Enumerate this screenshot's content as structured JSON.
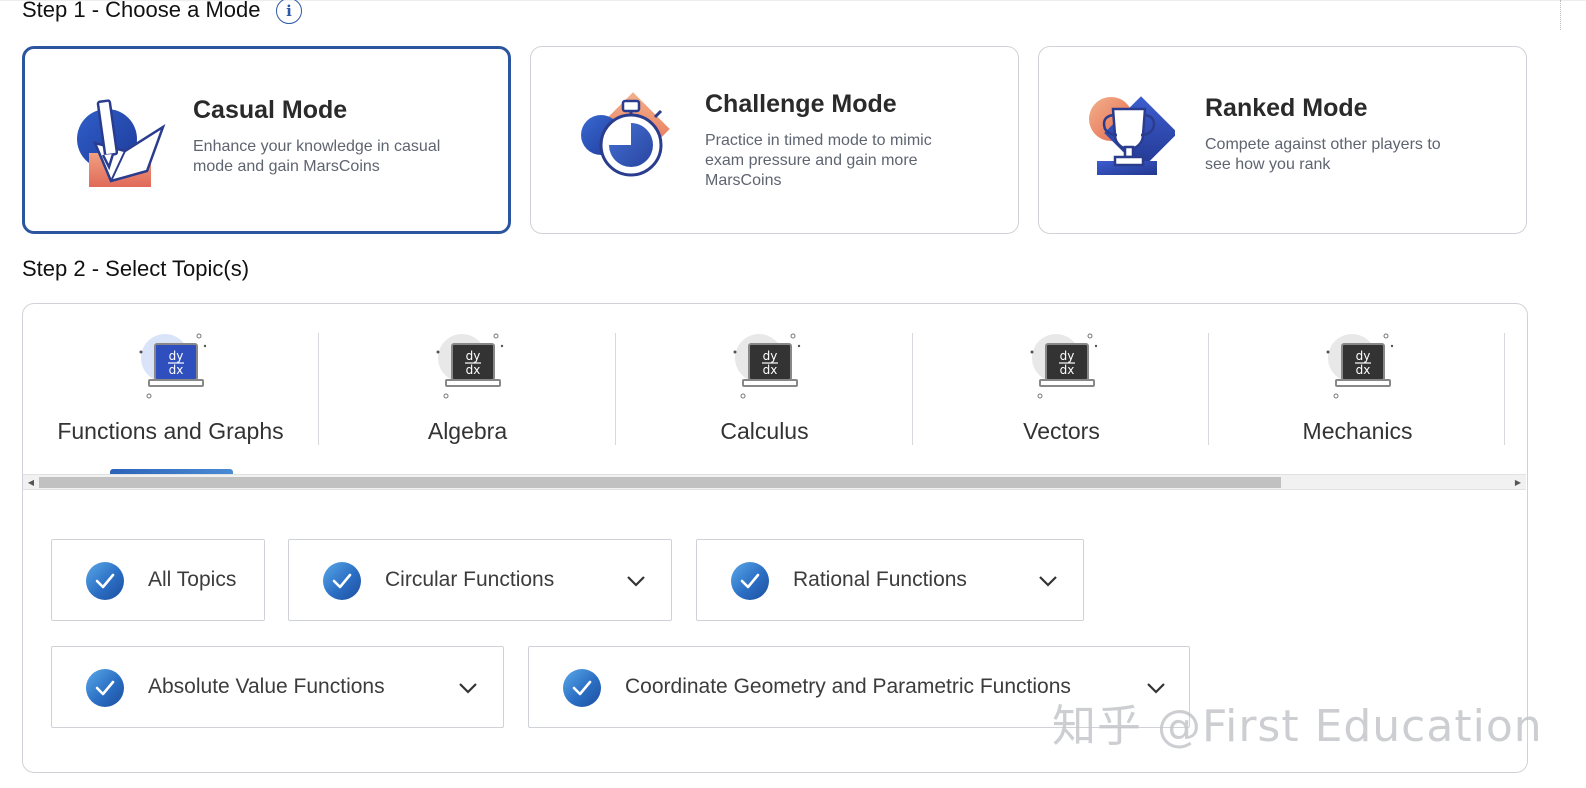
{
  "step1": {
    "heading": "Step 1 - Choose a Mode",
    "info_icon": "info-icon"
  },
  "modes": [
    {
      "title": "Casual Mode",
      "description": "Enhance your knowledge in casual mode and gain MarsCoins",
      "icon": "book-pencil-icon",
      "selected": true
    },
    {
      "title": "Challenge Mode",
      "description": "Practice in timed mode to mimic exam pressure and gain more MarsCoins",
      "icon": "stopwatch-icon",
      "selected": false
    },
    {
      "title": "Ranked Mode",
      "description": "Compete against other players to see how you rank",
      "icon": "trophy-icon",
      "selected": false
    }
  ],
  "step2": {
    "heading": "Step 2 - Select Topic(s)"
  },
  "topics": [
    {
      "label": "Functions and Graphs",
      "icon_text": "dy\ndx",
      "active": true
    },
    {
      "label": "Algebra",
      "icon_text": "dy\ndx",
      "active": false
    },
    {
      "label": "Calculus",
      "icon_text": "dy\ndx",
      "active": false
    },
    {
      "label": "Vectors",
      "icon_text": "dy\ndx",
      "active": false
    },
    {
      "label": "Mechanics",
      "icon_text": "dy\ndx",
      "active": false
    }
  ],
  "subtopics": [
    {
      "label": "All Topics",
      "checked": true,
      "has_dropdown": false
    },
    {
      "label": "Circular Functions",
      "checked": true,
      "has_dropdown": true
    },
    {
      "label": "Rational Functions",
      "checked": true,
      "has_dropdown": true
    },
    {
      "label": "Absolute Value Functions",
      "checked": true,
      "has_dropdown": true
    },
    {
      "label": "Coordinate Geometry and Parametric Functions",
      "checked": true,
      "has_dropdown": true
    }
  ],
  "watermark": "知乎 @First Education",
  "colors": {
    "accent": "#2c55a0",
    "check_gradient_start": "#5aa8e8",
    "check_gradient_end": "#1d4e9e",
    "watermark": "#c4c6c9"
  }
}
